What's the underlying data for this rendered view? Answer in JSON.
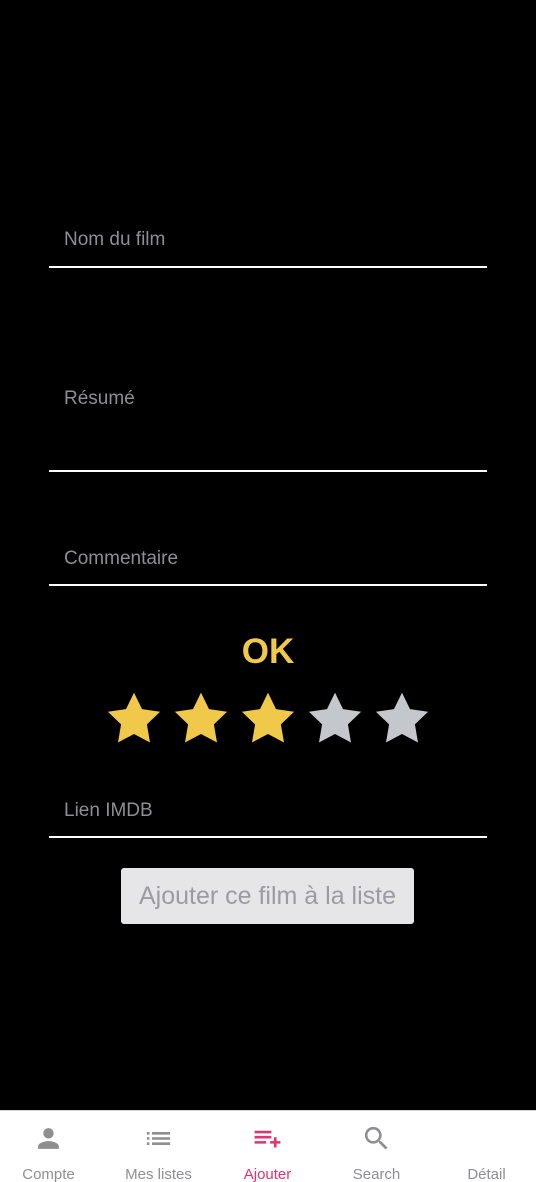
{
  "form": {
    "title_placeholder": "Nom du film",
    "summary_placeholder": "Résumé",
    "comment_placeholder": "Commentaire",
    "imdb_placeholder": "Lien IMDB"
  },
  "rating": {
    "label": "OK",
    "value": 3,
    "max": 5,
    "filled_color": "#f0c94a",
    "empty_color": "#c4c7cc"
  },
  "submit": {
    "label": "Ajouter ce film à la liste"
  },
  "tabbar": {
    "active_color": "#e0336f",
    "inactive_color": "#8e8e93",
    "tabs": [
      {
        "label": "Compte",
        "icon": "person-icon"
      },
      {
        "label": "Mes listes",
        "icon": "list-icon"
      },
      {
        "label": "Ajouter",
        "icon": "playlist-add-icon"
      },
      {
        "label": "Search",
        "icon": "search-icon"
      },
      {
        "label": "Détail",
        "icon": ""
      }
    ]
  }
}
